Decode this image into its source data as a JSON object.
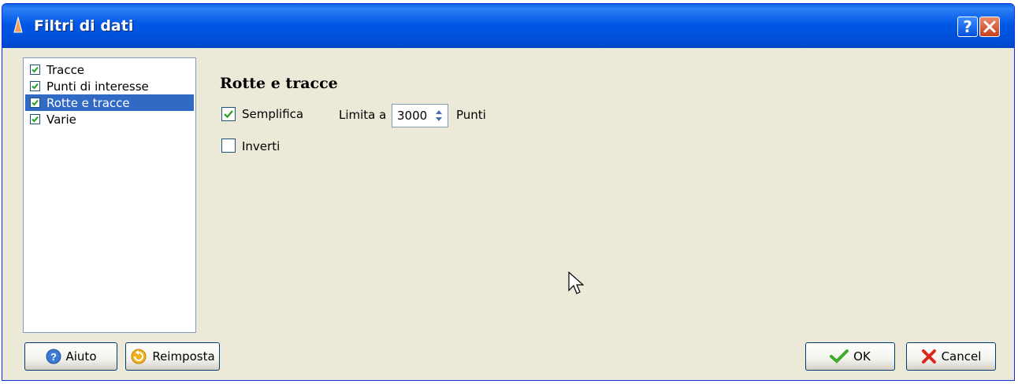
{
  "window": {
    "title": "Filtri di dati"
  },
  "pagelist": {
    "items": [
      {
        "label": "Tracce",
        "checked": true,
        "selected": false
      },
      {
        "label": "Punti di interesse",
        "checked": true,
        "selected": false
      },
      {
        "label": "Rotte e tracce",
        "checked": true,
        "selected": true
      },
      {
        "label": "Varie",
        "checked": true,
        "selected": false
      }
    ]
  },
  "main": {
    "section_title": "Rotte e tracce",
    "simplify": {
      "label": "Semplifica",
      "checked": true
    },
    "limit": {
      "label": "Limita a",
      "value": "3000",
      "unit": "Punti"
    },
    "invert": {
      "label": "Inverti",
      "checked": false
    }
  },
  "buttons": {
    "help": "Aiuto",
    "reset": "Reimposta",
    "ok": "OK",
    "cancel": "Cancel"
  },
  "colors": {
    "titlebar": "#0058e6",
    "selection": "#316ac5",
    "dialog_bg": "#ece9d8"
  },
  "icons": [
    "app-icon",
    "help-icon",
    "close-icon",
    "check-icon",
    "spin-arrows-icon",
    "help-circle-icon",
    "reset-icon",
    "ok-check-icon",
    "cancel-x-icon",
    "cursor-icon"
  ]
}
